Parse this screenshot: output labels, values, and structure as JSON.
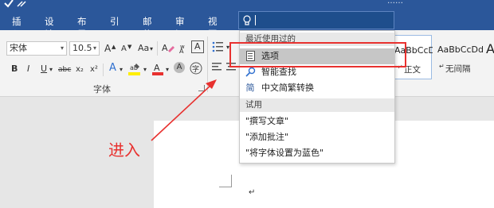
{
  "title_bar": {
    "right_text": "……"
  },
  "tabs": [
    {
      "label": "插入"
    },
    {
      "label": "设计"
    },
    {
      "label": "布局"
    },
    {
      "label": "引用"
    },
    {
      "label": "邮件"
    },
    {
      "label": "审阅"
    },
    {
      "label": "视图"
    }
  ],
  "tell_me": {
    "value": ""
  },
  "font_group": {
    "font_name": "宋体",
    "font_size": "10.5",
    "grow": "A",
    "shrink": "A",
    "change_case": "Aa",
    "bold": "B",
    "italic": "I",
    "underline": "U",
    "strikethrough": "abc",
    "subscript": "x₂",
    "superscript": "x²",
    "label": "字体"
  },
  "styles": [
    {
      "sample": "AaBbCcDd",
      "name": "正文"
    },
    {
      "sample": "AaBbCcDd",
      "name": "无间隔"
    }
  ],
  "dropdown": {
    "recent_header": "最近使用过的",
    "recent_items": [
      {
        "label": "选项",
        "icon": "options-icon"
      },
      {
        "label": "智能查找",
        "icon": "smart-lookup-icon"
      },
      {
        "label": "中文简繁转换",
        "icon": "chinese-conversion-icon"
      }
    ],
    "try_header": "试用",
    "try_items": [
      {
        "label": "\"撰写文章\""
      },
      {
        "label": "\"添加批注\""
      },
      {
        "label": "\"将字体设置为蓝色\""
      }
    ]
  },
  "annotation": {
    "text": "进入",
    "color": "#e8312f"
  },
  "colors": {
    "ribbon_blue": "#2b579a",
    "annotation_red": "#e8312f"
  }
}
